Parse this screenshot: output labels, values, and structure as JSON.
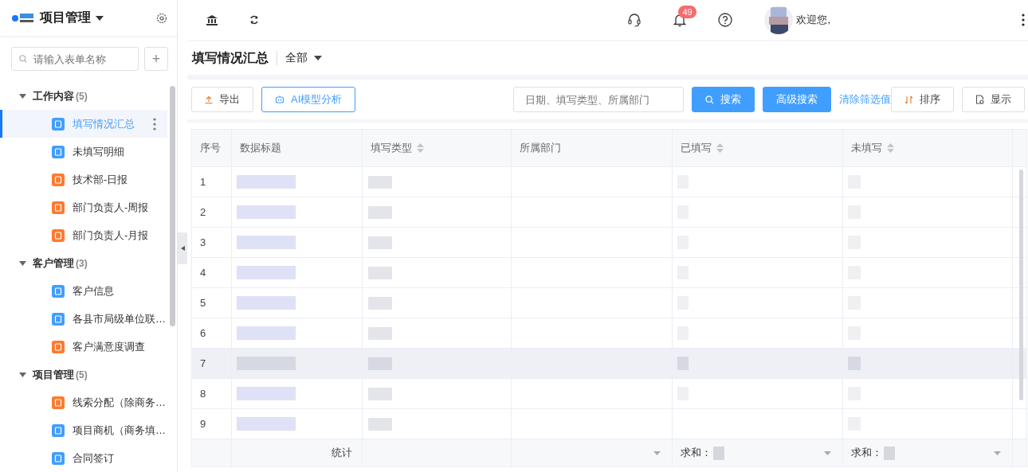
{
  "app": {
    "title": "项目管理"
  },
  "sidebar": {
    "search": {
      "placeholder": "请输入表单名称"
    },
    "add_button": "+",
    "groups": [
      {
        "label": "工作内容",
        "count": "(5)",
        "expanded": true,
        "children": [
          {
            "label": "填写情况汇总",
            "color": "#409eff",
            "selected": true
          },
          {
            "label": "未填写明细",
            "color": "#409eff",
            "selected": false
          },
          {
            "label": "技术部-日报",
            "color": "#ff7a2e",
            "selected": false
          },
          {
            "label": "部门负责人-周报",
            "color": "#ff7a2e",
            "selected": false
          },
          {
            "label": "部门负责人-月报",
            "color": "#ff7a2e",
            "selected": false
          }
        ]
      },
      {
        "label": "客户管理",
        "count": "(3)",
        "expanded": true,
        "children": [
          {
            "label": "客户信息",
            "color": "#409eff",
            "selected": false
          },
          {
            "label": "各县市局级单位联…",
            "color": "#409eff",
            "selected": false
          },
          {
            "label": "客户满意度调查",
            "color": "#ff7a2e",
            "selected": false
          }
        ]
      },
      {
        "label": "项目管理",
        "count": "(5)",
        "expanded": true,
        "children": [
          {
            "label": "线索分配（除商务…",
            "color": "#ff7a2e",
            "selected": false
          },
          {
            "label": "项目商机（商务填…",
            "color": "#409eff",
            "selected": false
          },
          {
            "label": "合同签订",
            "color": "#409eff",
            "selected": false
          }
        ]
      }
    ]
  },
  "topbar": {
    "notifications": "49",
    "greeting": "欢迎您,"
  },
  "page": {
    "title": "填写情况汇总",
    "filter": "全部"
  },
  "toolbar": {
    "export": "导出",
    "ai": "AI模型分析",
    "search": {
      "placeholder": "日期、填写类型、所属部门"
    },
    "search_button": "搜索",
    "advanced_button": "高级搜索",
    "clear_link": "清除筛选值",
    "sort_button": "排序",
    "display_button": "显示"
  },
  "table": {
    "columns": [
      {
        "label": "序号",
        "sortable": false
      },
      {
        "label": "数据标题",
        "sortable": false
      },
      {
        "label": "填写类型",
        "sortable": true
      },
      {
        "label": "所属部门",
        "sortable": false
      },
      {
        "label": "已填写",
        "sortable": true
      },
      {
        "label": "未填写",
        "sortable": true
      }
    ],
    "rows": [
      {
        "index": "1",
        "highlighted": false,
        "redacted": [
          true,
          true,
          true,
          true
        ]
      },
      {
        "index": "2",
        "highlighted": false,
        "redacted": [
          true,
          true,
          true,
          true
        ]
      },
      {
        "index": "3",
        "highlighted": false,
        "redacted": [
          true,
          true,
          true,
          true
        ]
      },
      {
        "index": "4",
        "highlighted": false,
        "redacted": [
          true,
          true,
          true,
          true
        ]
      },
      {
        "index": "5",
        "highlighted": false,
        "redacted": [
          true,
          true,
          true,
          true
        ]
      },
      {
        "index": "6",
        "highlighted": false,
        "redacted": [
          true,
          true,
          true,
          true
        ]
      },
      {
        "index": "7",
        "highlighted": true,
        "redacted": [
          true,
          true,
          true,
          true
        ]
      },
      {
        "index": "8",
        "highlighted": false,
        "redacted": [
          true,
          true,
          true,
          true
        ]
      },
      {
        "index": "9",
        "highlighted": false,
        "redacted": [
          true,
          true,
          false,
          true
        ]
      }
    ],
    "footer": {
      "label": "统计",
      "sum_label_1": "求和：",
      "sum_label_2": "求和："
    }
  }
}
